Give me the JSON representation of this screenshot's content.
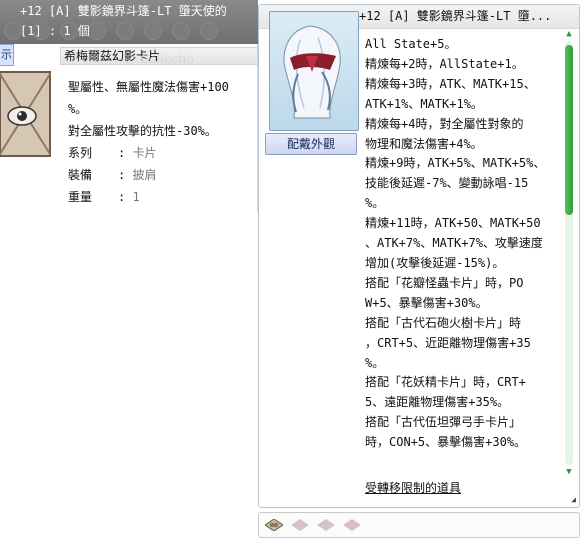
{
  "card_window": {
    "header_line1": "+12 [A] 雙影鏡界斗篷-LT 墮天使的",
    "header_line2": "[1] : 1 個",
    "tab_label": "示",
    "card_name": "希梅爾茲幻影卡片",
    "watermark": "Collectio",
    "description_line1": "聖屬性、無屬性魔法傷害+100",
    "description_line2": "%。",
    "description_line3": "對全屬性攻擊的抗性-30%。",
    "type_label": "系列",
    "type_value": "卡片",
    "equip_label": "裝備",
    "equip_value": "披肩",
    "weight_label": "重量",
    "weight_value": "1"
  },
  "item_window": {
    "title": "+12 [A] 雙影鏡界斗篷-LT 墮...",
    "equip_appearance_button": "配戴外觀",
    "description_lines": [
      "All State+5。",
      "精煉每+2時，AllState+1。",
      "精煉每+3時，ATK、MATK+15、",
      "ATK+1%、MATK+1%。",
      "精煉每+4時，對全屬性對象的",
      "物理和魔法傷害+4%。",
      "精煉+9時，ATK+5%、MATK+5%、",
      "技能後延遲-7%、變動詠唱-15",
      "%。",
      "精煉+11時，ATK+50、MATK+50",
      "、ATK+7%、MATK+7%、攻擊速度",
      "增加(攻擊後延遲-15%)。",
      "搭配「花瓣怪蟲卡片」時，PO",
      "W+5、暴擊傷害+30%。",
      "搭配「古代石砲火樹卡片」時",
      "，CRT+5、近距離物理傷害+35",
      "%。",
      "搭配「花妖精卡片」時，CRT+",
      "5、遠距離物理傷害+35%。",
      "搭配「古代伍坦彈弓手卡片」",
      "時，CON+5、暴擊傷害+30%。"
    ],
    "restriction_text": "受轉移限制的道具",
    "scroll_up": "▲",
    "scroll_down": "▼",
    "resize_glyph": "◢"
  },
  "slots": {
    "icon": "card-slot-icon",
    "empty_count": 3
  },
  "colors": {
    "scroll_green": "#2f9a3e",
    "button_blue": "#cdd6f3",
    "header_gray": "#6f6f6f"
  }
}
